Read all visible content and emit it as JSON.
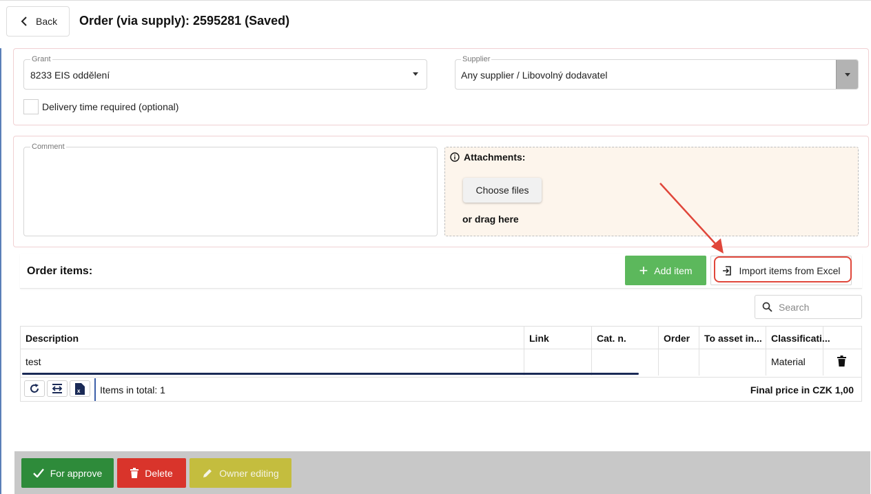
{
  "header": {
    "back_label": "Back",
    "title": "Order (via supply): 2595281 (Saved)"
  },
  "form": {
    "grant_label": "Grant",
    "grant_value": "8233 EIS oddělení",
    "supplier_label": "Supplier",
    "supplier_value": "Any supplier / Libovolný dodavatel",
    "delivery_checkbox_label": "Delivery time required (optional)",
    "comment_label": "Comment"
  },
  "attachments": {
    "title": "Attachments:",
    "choose_label": "Choose files",
    "drag_text": "or drag here"
  },
  "items": {
    "title": "Order items:",
    "add_label": "Add item",
    "import_label": "Import items from Excel",
    "search_placeholder": "Search",
    "columns": [
      "Description",
      "Link",
      "Cat. n.",
      "Order",
      "To asset in...",
      "Classificati..."
    ],
    "rows": [
      {
        "description": "test",
        "link": "",
        "cat": "",
        "order": "",
        "asset": "",
        "classification": "Material"
      }
    ],
    "total_text": "Items in total: 1",
    "final_price_label": "Final price in CZK",
    "final_price_value": "1,00"
  },
  "actions": {
    "approve_label": "For approve",
    "delete_label": "Delete",
    "owner_label": "Owner editing"
  },
  "colors": {
    "approve": "#2e8b3a",
    "delete": "#d9342b",
    "owner": "#c4bd3e",
    "add": "#5cb85c",
    "highlight": "#e0463a"
  }
}
